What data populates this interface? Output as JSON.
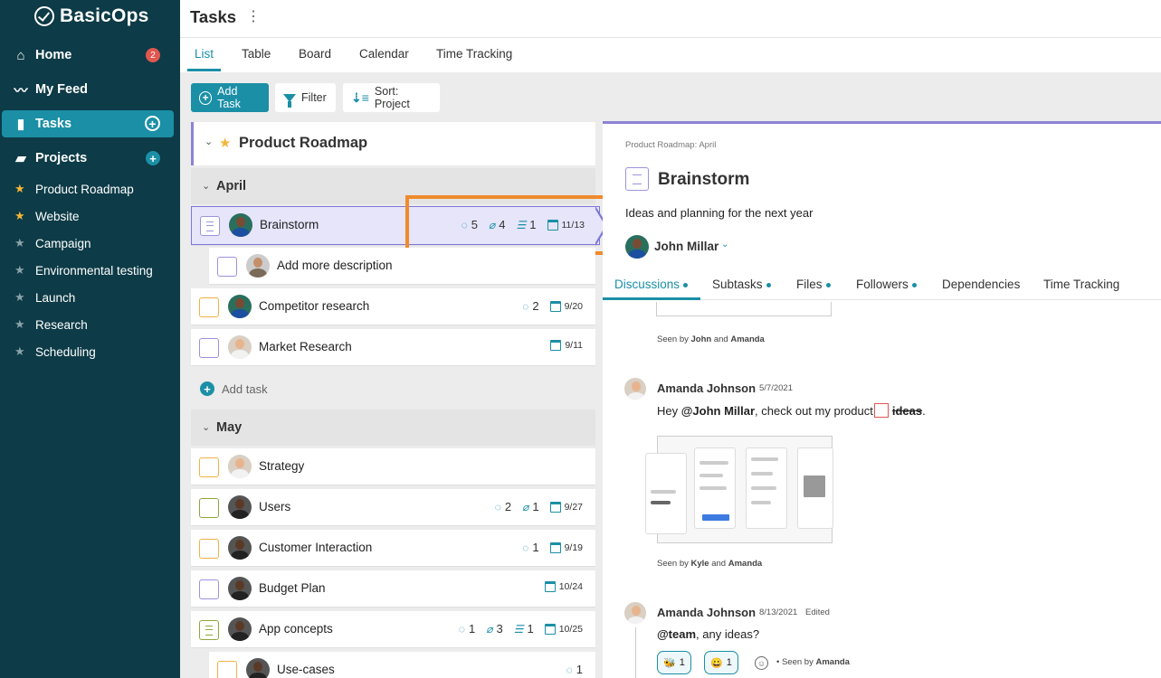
{
  "app": {
    "name": "BasicOps"
  },
  "sidebar": {
    "nav": [
      {
        "label": "Home",
        "icon": "home-icon",
        "badge": "2"
      },
      {
        "label": "My Feed",
        "icon": "pulse-icon"
      },
      {
        "label": "Tasks",
        "icon": "clipboard-icon",
        "active": true
      },
      {
        "label": "Projects",
        "icon": "folder-icon"
      }
    ],
    "projects": [
      {
        "label": "Product Roadmap",
        "favorite": true
      },
      {
        "label": "Website",
        "favorite": true
      },
      {
        "label": "Campaign",
        "favorite": false
      },
      {
        "label": "Environmental testing",
        "favorite": false
      },
      {
        "label": "Launch",
        "favorite": false
      },
      {
        "label": "Research",
        "favorite": false
      },
      {
        "label": "Scheduling",
        "favorite": false
      }
    ]
  },
  "header": {
    "title": "Tasks"
  },
  "tabs": [
    "List",
    "Table",
    "Board",
    "Calendar",
    "Time Tracking"
  ],
  "toolbar": {
    "add_task": "Add Task",
    "filter": "Filter",
    "sort": "Sort: Project"
  },
  "list": {
    "project": "Product Roadmap",
    "groups": [
      {
        "name": "April"
      },
      {
        "name": "May"
      }
    ],
    "april_tasks": [
      {
        "name": "Brainstorm",
        "comments": "5",
        "attachments": "4",
        "subtasks": "1",
        "date": "11/13"
      },
      {
        "name": "Add more description"
      },
      {
        "name": "Competitor research",
        "comments": "2",
        "date": "9/20"
      },
      {
        "name": "Market Research",
        "date": "9/11"
      }
    ],
    "add_task": "Add task",
    "may_tasks": [
      {
        "name": "Strategy"
      },
      {
        "name": "Users",
        "comments": "2",
        "attachments": "1",
        "date": "9/27"
      },
      {
        "name": "Customer Interaction",
        "comments": "1",
        "date": "9/19"
      },
      {
        "name": "Budget Plan",
        "date": "10/24"
      },
      {
        "name": "App concepts",
        "comments": "1",
        "attachments": "3",
        "subtasks": "1",
        "date": "10/25"
      },
      {
        "name": "Use-cases",
        "comments": "1"
      }
    ]
  },
  "detail": {
    "breadcrumb": "Product Roadmap: April",
    "title": "Brainstorm",
    "description": "Ideas and planning for the next year",
    "owner": "John Millar",
    "tabs": [
      "Discussions",
      "Subtasks",
      "Files",
      "Followers",
      "Dependencies",
      "Time Tracking"
    ],
    "seen1": {
      "prefix": "Seen by",
      "a": "John",
      "and": "and",
      "b": "Amanda"
    },
    "comment1": {
      "author": "Amanda Johnson",
      "date": "5/7/2021",
      "pre": "Hey",
      "mention": "@John Millar",
      "mid": ", check out my product",
      "struck": "ideas",
      "end": "."
    },
    "seen2": {
      "prefix": "Seen by",
      "a": "Kyle",
      "and": "and",
      "b": "Amanda"
    },
    "comment2": {
      "author": "Amanda Johnson",
      "date": "8/13/2021",
      "edited": "Edited",
      "mention": "@team",
      "text": ", any ideas?",
      "reactions": [
        {
          "emoji": "🐝",
          "count": "1"
        },
        {
          "emoji": "😀",
          "count": "1"
        }
      ],
      "seen": "Seen by",
      "seen_name": "Amanda"
    }
  },
  "colors": {
    "sidebar": "#0d3b47",
    "accent": "#1b8fa6",
    "highlight": "#f08a2c",
    "selected": "#e6e5fa"
  }
}
